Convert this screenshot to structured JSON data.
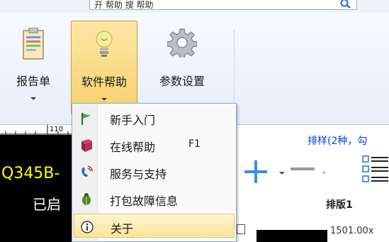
{
  "search": {
    "text": "开 帮助 搜 帮助"
  },
  "ribbon": {
    "buttons": [
      {
        "label": "报告单",
        "icon": "clipboard-report-icon"
      },
      {
        "label": "软件帮助",
        "icon": "lightbulb-icon"
      },
      {
        "label": "参数设置",
        "icon": "gear-icon"
      }
    ]
  },
  "canvas": {
    "ruler_mark": "110",
    "code_text": "Q345B-",
    "status_text": "已启"
  },
  "panel": {
    "title": "排样(2种，勾",
    "layout_label": "排版1",
    "value": "1501.00x"
  },
  "menu": {
    "items": [
      {
        "label": "新手入门",
        "icon": "green-flag-icon",
        "shortcut": ""
      },
      {
        "label": "在线帮助",
        "icon": "help-book-icon",
        "shortcut": "F1"
      },
      {
        "label": "服务与支持",
        "icon": "support-phone-icon",
        "shortcut": ""
      },
      {
        "label": "打包故障信息",
        "icon": "bug-icon",
        "shortcut": ""
      },
      {
        "label": "关于",
        "icon": "info-icon",
        "shortcut": ""
      }
    ]
  },
  "colors": {
    "active_button": "#f8cf6c",
    "menu_hover": "#fde49a",
    "link_blue": "#0044cc",
    "code_yellow": "#ffff00"
  }
}
